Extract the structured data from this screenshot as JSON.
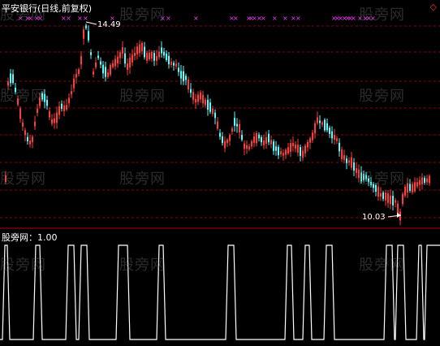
{
  "header": {
    "title": "平安银行(日线,前复权)"
  },
  "indicator": {
    "label": "股旁网：1.00"
  },
  "watermark": {
    "text": "股旁网"
  },
  "annotations": {
    "high_label": "14.49",
    "low_label": "10.03"
  },
  "icons": {
    "corner": "diamond-icon"
  },
  "colors": {
    "background": "#000000",
    "up_candle": "#ff3b3b",
    "down_candle": "#54ffff",
    "grid": "#8b0000",
    "marker": "#ff33ff",
    "indicator_line": "#ffffff",
    "title_text": "#ffffff",
    "label_text": "#ffffff",
    "corner_icon": "#ff3333"
  }
}
